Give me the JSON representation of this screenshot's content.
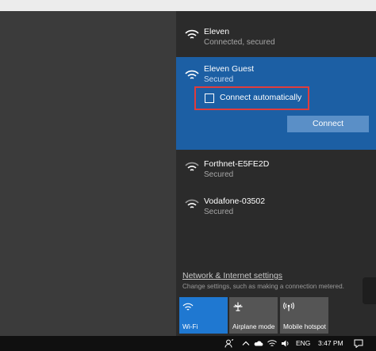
{
  "networks": [
    {
      "name": "Eleven",
      "status": "Connected, secured",
      "icon": "wifi-icon"
    },
    {
      "name": "Eleven Guest",
      "status": "Secured",
      "icon": "wifi-icon"
    },
    {
      "name": "Forthnet-E5FE2D",
      "status": "Secured",
      "icon": "wifi-icon"
    },
    {
      "name": "Vodafone-03502",
      "status": "Secured",
      "icon": "wifi-icon"
    }
  ],
  "selected": {
    "connect_automatically_label": "Connect automatically",
    "connect_automatically_checked": false,
    "connect_button_label": "Connect"
  },
  "settings": {
    "link_label": "Network & Internet settings",
    "description": "Change settings, such as making a connection metered."
  },
  "quick_actions": [
    {
      "label": "Wi-Fi",
      "icon": "wifi-icon",
      "active": true
    },
    {
      "label": "Airplane mode",
      "icon": "airplane-icon",
      "active": false
    },
    {
      "label": "Mobile hotspot",
      "icon": "hotspot-icon",
      "active": false
    }
  ],
  "taskbar": {
    "language": "ENG",
    "time": "3:47 PM",
    "icons": [
      "people-icon",
      "chevron-up-icon",
      "onedrive-icon",
      "network-icon",
      "volume-icon",
      "notification-icon"
    ]
  },
  "colors": {
    "panel_background": "#2b2b2b",
    "selected_network": "#1c5fa4",
    "connect_button": "#5a8fc7",
    "highlight_border": "#e03c3c",
    "active_tile": "#1f78d1",
    "inactive_tile": "#555555"
  }
}
